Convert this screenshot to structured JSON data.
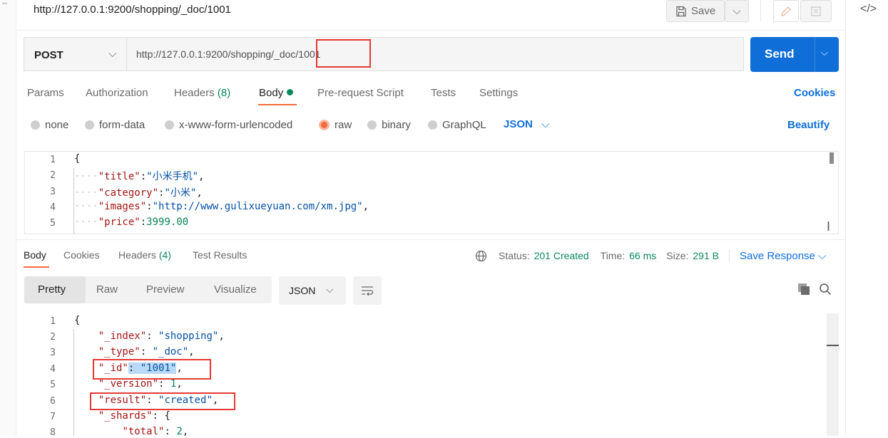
{
  "request": {
    "title": "http://127.0.0.1:9200/shopping/_doc/1001",
    "method": "POST",
    "url_base": "http://127.0.0.1:9200/shopping/_doc/",
    "url_id": "1001"
  },
  "toolbar": {
    "save_label": "Save",
    "send_label": "Send"
  },
  "req_tabs": {
    "params": "Params",
    "authorization": "Authorization",
    "headers": "Headers",
    "headers_count": "(8)",
    "body": "Body",
    "pre_request": "Pre-request Script",
    "tests": "Tests",
    "settings": "Settings",
    "cookies": "Cookies"
  },
  "body_types": {
    "none": "none",
    "form_data": "form-data",
    "urlencoded": "x-www-form-urlencoded",
    "raw": "raw",
    "binary": "binary",
    "graphql": "GraphQL",
    "json": "JSON",
    "beautify": "Beautify"
  },
  "request_body": {
    "line_numbers": [
      "1",
      "2",
      "3",
      "4",
      "5"
    ],
    "brace": "{",
    "title_key": "\"title\"",
    "title_val": "\"小米手机\"",
    "category_key": "\"category\"",
    "category_val": "\"小米\"",
    "images_key": "\"images\"",
    "images_val": "\"http://www.gulixueyuan.com/xm.jpg\"",
    "price_key": "\"price\"",
    "price_val": "3999.00"
  },
  "resp_tabs": {
    "body": "Body",
    "cookies": "Cookies",
    "headers": "Headers",
    "headers_count": "(4)",
    "test_results": "Test Results"
  },
  "status": {
    "status_label": "Status:",
    "status_value": "201 Created",
    "time_label": "Time:",
    "time_value": "66 ms",
    "size_label": "Size:",
    "size_value": "291 B",
    "save_response": "Save Response"
  },
  "view": {
    "pretty": "Pretty",
    "raw": "Raw",
    "preview": "Preview",
    "visualize": "Visualize",
    "format": "JSON"
  },
  "response_body": {
    "line_numbers": [
      "1",
      "2",
      "3",
      "4",
      "5",
      "6",
      "7",
      "8"
    ],
    "open_brace": "{",
    "index_key": "\"_index\"",
    "index_val": "\"shopping\"",
    "type_key": "\"_type\"",
    "type_val": "\"_doc\"",
    "id_key": "\"_id\"",
    "id_val": "\"1001\"",
    "version_key": "\"_version\"",
    "version_val": "1",
    "result_key": "\"result\"",
    "result_val": "\"created\"",
    "shards_key": "\"_shards\"",
    "shards_open": "{",
    "total_key": "\"total\"",
    "total_val": "2"
  },
  "colors": {
    "accent": "#f26b3a",
    "send": "#0f6ed8",
    "success": "#0a8a5b",
    "annotation": "#e53935"
  }
}
